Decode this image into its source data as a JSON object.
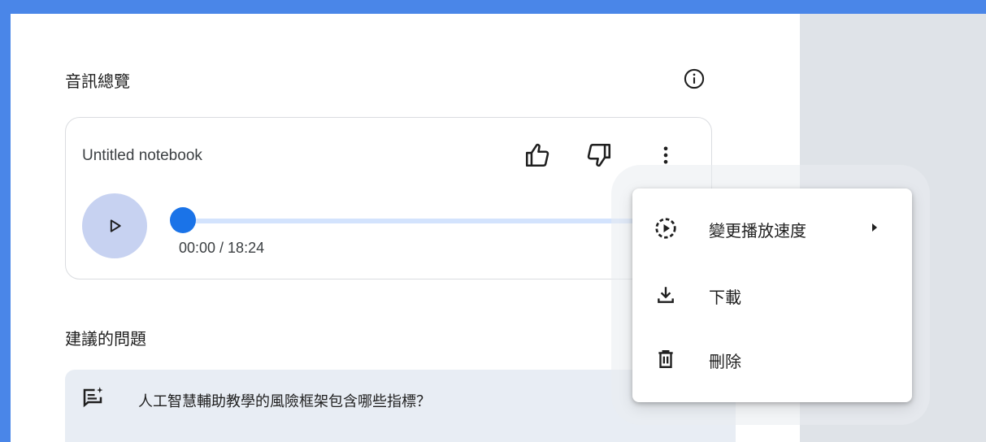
{
  "audio_overview": {
    "title": "音訊總覽",
    "info_icon": "info-icon",
    "card": {
      "notebook_title": "Untitled notebook",
      "actions": [
        "thumbs-up-icon",
        "thumbs-down-icon",
        "more-vert-icon"
      ],
      "player": {
        "play_icon": "play-icon",
        "time": "00:00 / 18:24",
        "progress": 0
      }
    }
  },
  "suggested": {
    "title": "建議的問題",
    "questions": [
      {
        "icon": "add-comment-icon",
        "text": "人工智慧輔助教學的風險框架包含哪些指標？"
      }
    ]
  },
  "menu": {
    "items": [
      {
        "icon": "playback-speed-icon",
        "label": "變更播放速度",
        "has_submenu": true
      },
      {
        "icon": "download-icon",
        "label": "下載"
      },
      {
        "icon": "delete-icon",
        "label": "刪除"
      }
    ]
  },
  "colors": {
    "frame": "#4a86e8",
    "accent": "#1a73e8",
    "track": "#d3e3fd",
    "play_button": "#c7d2f1",
    "question_bg": "#e8edf4",
    "side_strip": "#dfe3e8"
  }
}
